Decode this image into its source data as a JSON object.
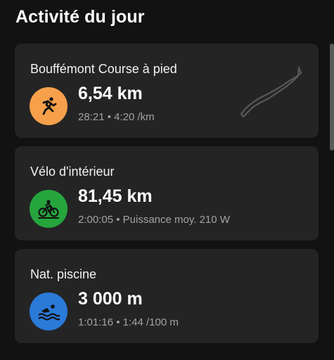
{
  "header": {
    "title": "Activité du jour"
  },
  "activities": [
    {
      "name": "Bouffémont Course à pied",
      "distance": "6,54 km",
      "details": "28:21 • 4:20 /km",
      "icon": "running-icon",
      "icon_color": "#f7a04b"
    },
    {
      "name": "Vélo d'intérieur",
      "distance": "81,45 km",
      "details": "2:00:05 • Puissance moy. 210 W",
      "icon": "indoor-bike-icon",
      "icon_color": "#26a53d"
    },
    {
      "name": "Nat. piscine",
      "distance": "3 000 m",
      "details": "1:01:16 • 1:44 /100 m",
      "icon": "swimming-icon",
      "icon_color": "#2a7ad8"
    }
  ]
}
